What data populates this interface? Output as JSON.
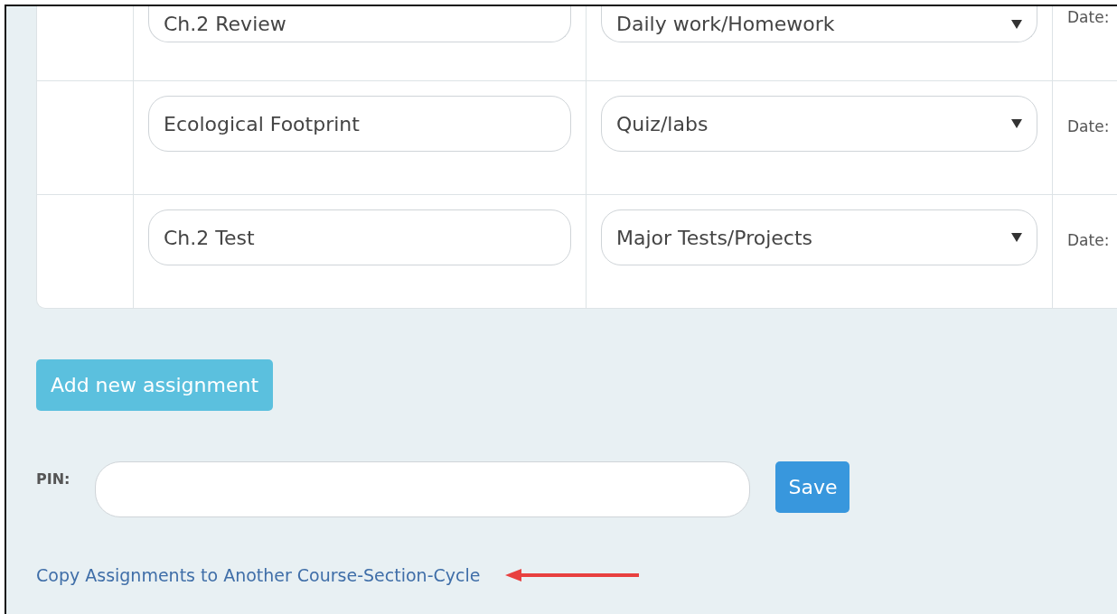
{
  "assignments": [
    {
      "name": "Ch.2 Review",
      "category": "Daily work/Homework",
      "date_label": "Date:"
    },
    {
      "name": "Ecological Footprint",
      "category": "Quiz/labs",
      "date_label": "Date:"
    },
    {
      "name": "Ch.2 Test",
      "category": "Major Tests/Projects",
      "date_label": "Date:"
    }
  ],
  "add_button": "Add new assignment",
  "pin": {
    "label": "PIN:"
  },
  "save_button": "Save",
  "copy_link": "Copy Assignments to Another Course-Section-Cycle"
}
